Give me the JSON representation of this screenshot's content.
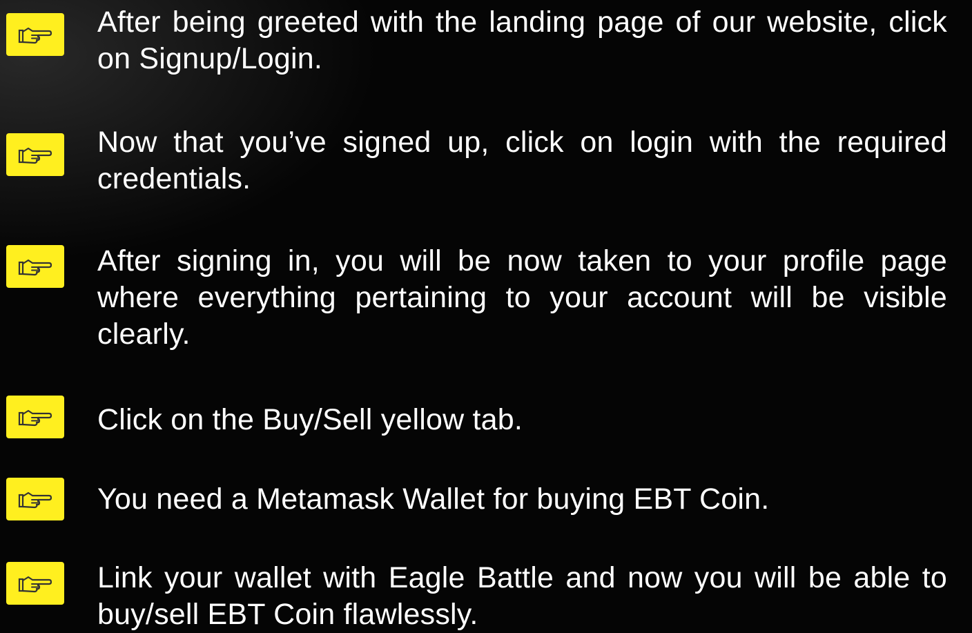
{
  "icon": "pointing-hand-icon",
  "colors": {
    "background": "#050505",
    "icon_box": "#ffef1f",
    "text": "#ffffff"
  },
  "steps": [
    {
      "text": "After being greeted with the landing page of our website, click on Signup/Login."
    },
    {
      "text": "Now that you’ve signed up, click on login with the required credentials."
    },
    {
      "text": "After signing in, you will be now taken to your profile page where everything pertaining to your account will be visible clearly."
    },
    {
      "text": "Click on the Buy/Sell yellow tab."
    },
    {
      "text": "You need a Metamask Wallet for buying EBT Coin."
    },
    {
      "text": "Link your wallet with Eagle Battle and now you will be able to buy/sell EBT Coin flawlessly."
    }
  ]
}
